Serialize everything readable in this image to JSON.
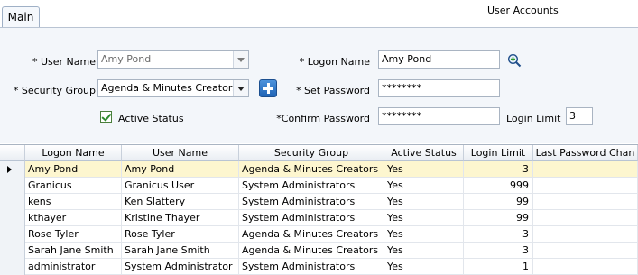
{
  "tabs": [
    {
      "label": "Main"
    }
  ],
  "window_title": "User Accounts",
  "form": {
    "user_name": {
      "label": "* User Name",
      "value": "Amy Pond"
    },
    "security_group": {
      "label": "* Security Group",
      "value": "Agenda & Minutes Creators"
    },
    "active_status": {
      "label": "Active Status",
      "checked": true
    },
    "logon_name": {
      "label": "* Logon Name",
      "value": "Amy Pond"
    },
    "set_password": {
      "label": "* Set Password",
      "value": "********"
    },
    "confirm_password": {
      "label": "*Confirm Password",
      "value": "********"
    },
    "login_limit": {
      "label": "Login Limit",
      "value": "3"
    }
  },
  "grid": {
    "columns": [
      "Logon  Name",
      "User Name",
      "Security Group",
      "Active Status",
      "Login Limit",
      "Last Password Chan"
    ],
    "sort_indicator": "/",
    "rows": [
      {
        "logon": "Amy Pond",
        "user": "Amy Pond",
        "group": "Agenda & Minutes Creators",
        "active": "Yes",
        "limit": "3",
        "last": ""
      },
      {
        "logon": "Granicus",
        "user": "Granicus User",
        "group": "System Administrators",
        "active": "Yes",
        "limit": "999",
        "last": ""
      },
      {
        "logon": "kens",
        "user": "Ken Slattery",
        "group": "System Administrators",
        "active": "Yes",
        "limit": "99",
        "last": ""
      },
      {
        "logon": "kthayer",
        "user": "Kristine Thayer",
        "group": "System Administrators",
        "active": "Yes",
        "limit": "99",
        "last": ""
      },
      {
        "logon": "Rose Tyler",
        "user": "Rose Tyler",
        "group": "Agenda & Minutes Creators",
        "active": "Yes",
        "limit": "3",
        "last": ""
      },
      {
        "logon": "Sarah Jane Smith",
        "user": "Sarah Jane Smith",
        "group": "Agenda & Minutes Creators",
        "active": "Yes",
        "limit": "3",
        "last": ""
      },
      {
        "logon": "administrator",
        "user": "System Administrator",
        "group": "System Administrators",
        "active": "Yes",
        "limit": "1",
        "last": ""
      }
    ],
    "selected_row": 0
  },
  "colors": {
    "selected_row_bg": "#fdf6cf",
    "add_button": "#2a76c8",
    "panel_bg": "#f3f6fa"
  },
  "icons": {
    "lookup": "magnifier-plus-icon",
    "add": "plus-icon",
    "check": "check-icon",
    "row_pointer": "row-pointer-icon"
  }
}
